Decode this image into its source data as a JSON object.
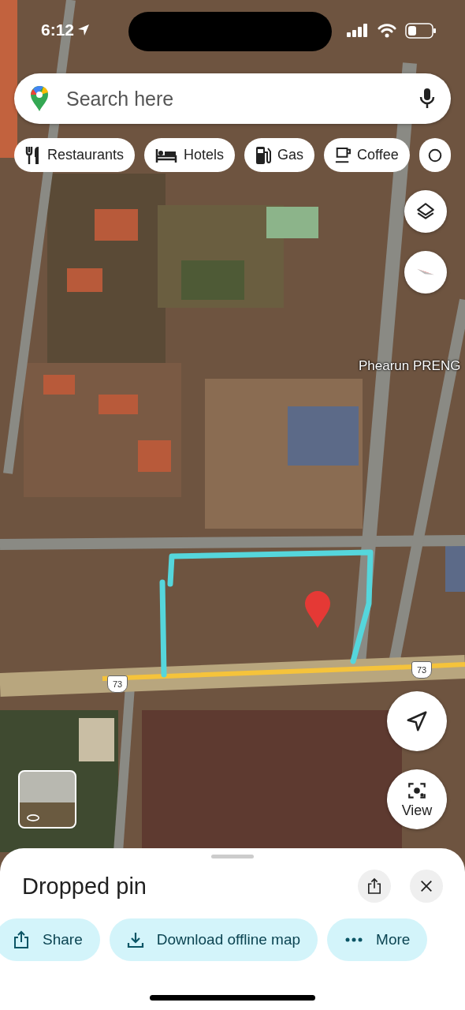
{
  "status_bar": {
    "time": "6:12"
  },
  "search": {
    "placeholder": "Search here"
  },
  "chips": [
    {
      "kind": "restaurant",
      "label": "Restaurants"
    },
    {
      "kind": "hotel",
      "label": "Hotels"
    },
    {
      "kind": "gas",
      "label": "Gas"
    },
    {
      "kind": "coffee",
      "label": "Coffee"
    },
    {
      "kind": "more"
    }
  ],
  "map": {
    "place_label": "Phearun PRENG",
    "route_shields": [
      "73",
      "73"
    ]
  },
  "view_button": {
    "label": "View"
  },
  "sheet": {
    "title": "Dropped pin",
    "actions": [
      {
        "kind": "share",
        "label": "Share"
      },
      {
        "kind": "download",
        "label": "Download offline map"
      },
      {
        "kind": "more",
        "label": "More"
      }
    ]
  }
}
